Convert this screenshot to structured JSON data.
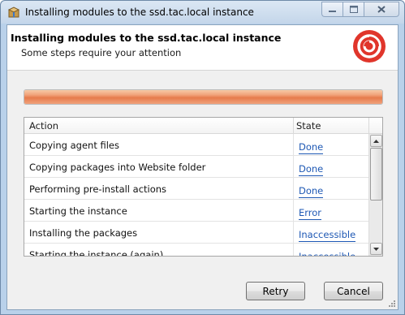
{
  "window": {
    "title": "Installing modules to the ssd.tac.local instance",
    "app_icon": "installer-box-icon",
    "controls": {
      "minimize_icon": "minimize-icon",
      "maximize_icon": "maximize-icon",
      "close_icon": "close-icon"
    }
  },
  "header": {
    "title": "Installing modules to the ssd.tac.local instance",
    "subtitle": "Some steps require your attention",
    "logo": "sitecore-logo-icon"
  },
  "progress": {
    "fraction": 1.0,
    "status_color": "#e67b4c"
  },
  "table": {
    "columns": [
      "Action",
      "State"
    ],
    "rows": [
      {
        "action": "Copying agent files",
        "state": "Done"
      },
      {
        "action": "Copying packages into Website folder",
        "state": "Done"
      },
      {
        "action": "Performing pre-install actions",
        "state": "Done"
      },
      {
        "action": "Starting the instance",
        "state": "Error"
      },
      {
        "action": "Installing the packages",
        "state": "Inaccessible"
      },
      {
        "action": "Starting the instance (again)",
        "state": "Inaccessible"
      }
    ]
  },
  "buttons": {
    "retry": "Retry",
    "cancel": "Cancel"
  },
  "colors": {
    "link": "#1e58b4",
    "logo_red": "#e0352b"
  }
}
